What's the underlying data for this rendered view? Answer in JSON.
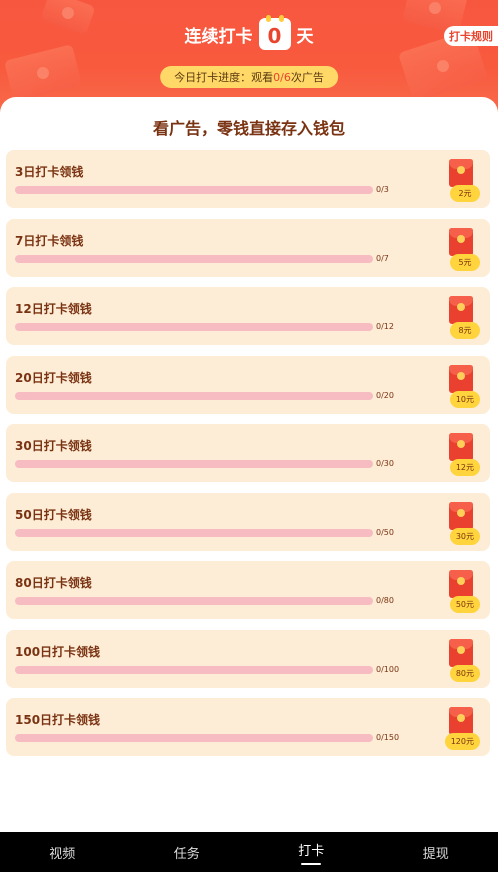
{
  "header": {
    "title_prefix": "连续打卡",
    "streak_days": "0",
    "title_suffix": "天",
    "rules_label": "打卡规则",
    "progress_text_prefix": "今日打卡进度：观看",
    "progress_value": "0/6",
    "progress_text_suffix": "次广告"
  },
  "main": {
    "heading": "看广告，零钱直接存入钱包",
    "rewards": [
      {
        "label": "3日打卡领钱",
        "count": "0/3",
        "amount": "2元",
        "progress": 0
      },
      {
        "label": "7日打卡领钱",
        "count": "0/7",
        "amount": "5元",
        "progress": 0
      },
      {
        "label": "12日打卡领钱",
        "count": "0/12",
        "amount": "8元",
        "progress": 0
      },
      {
        "label": "20日打卡领钱",
        "count": "0/20",
        "amount": "10元",
        "progress": 0
      },
      {
        "label": "30日打卡领钱",
        "count": "0/30",
        "amount": "12元",
        "progress": 0
      },
      {
        "label": "50日打卡领钱",
        "count": "0/50",
        "amount": "30元",
        "progress": 0
      },
      {
        "label": "80日打卡领钱",
        "count": "0/80",
        "amount": "50元",
        "progress": 0
      },
      {
        "label": "100日打卡领钱",
        "count": "0/100",
        "amount": "80元",
        "progress": 0
      },
      {
        "label": "150日打卡领钱",
        "count": "0/150",
        "amount": "120元",
        "progress": 0
      }
    ]
  },
  "tabbar": {
    "items": [
      {
        "label": "视频"
      },
      {
        "label": "任务"
      },
      {
        "label": "打卡"
      },
      {
        "label": "提现"
      }
    ],
    "active_label": "打卡"
  },
  "colors": {
    "header_red": "#f7573f",
    "accent_red": "#e8442e",
    "card_bg": "#fdecd6",
    "bar_track": "#f7bcc2",
    "gold": "#ffd43c"
  }
}
